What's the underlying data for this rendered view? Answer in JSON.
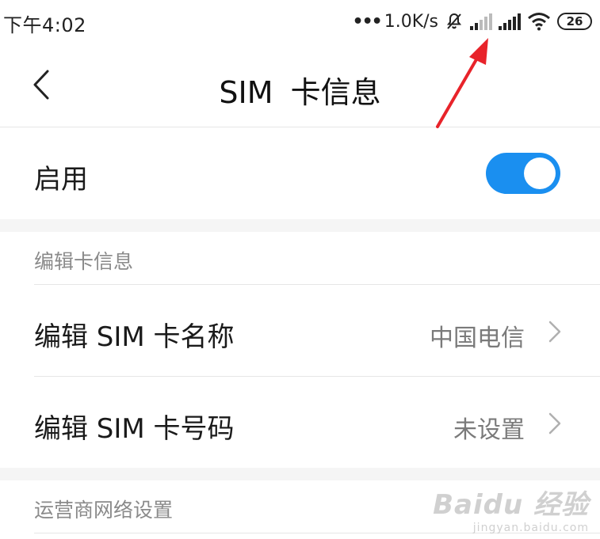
{
  "status_bar": {
    "time": "下午4:02",
    "net_dots": "•••",
    "net_speed": "1.0K/s",
    "battery": "26"
  },
  "header": {
    "title": "SIM  卡信息",
    "back_icon": "chevron-left-icon"
  },
  "enable_row": {
    "label": "启用",
    "toggle_on": true,
    "toggle_color": "#1a8ff0"
  },
  "section_edit": {
    "header": "编辑卡信息",
    "items": [
      {
        "label": "编辑 SIM 卡名称",
        "value": "中国电信"
      },
      {
        "label": "编辑 SIM 卡号码",
        "value": "未设置"
      }
    ]
  },
  "section_carrier": {
    "header": "运营商网络设置"
  },
  "watermark": {
    "main": "Baidu 经验",
    "sub": "jingyan.baidu.com"
  },
  "colors": {
    "accent": "#1a8ff0",
    "annotation": "#e8232a"
  }
}
